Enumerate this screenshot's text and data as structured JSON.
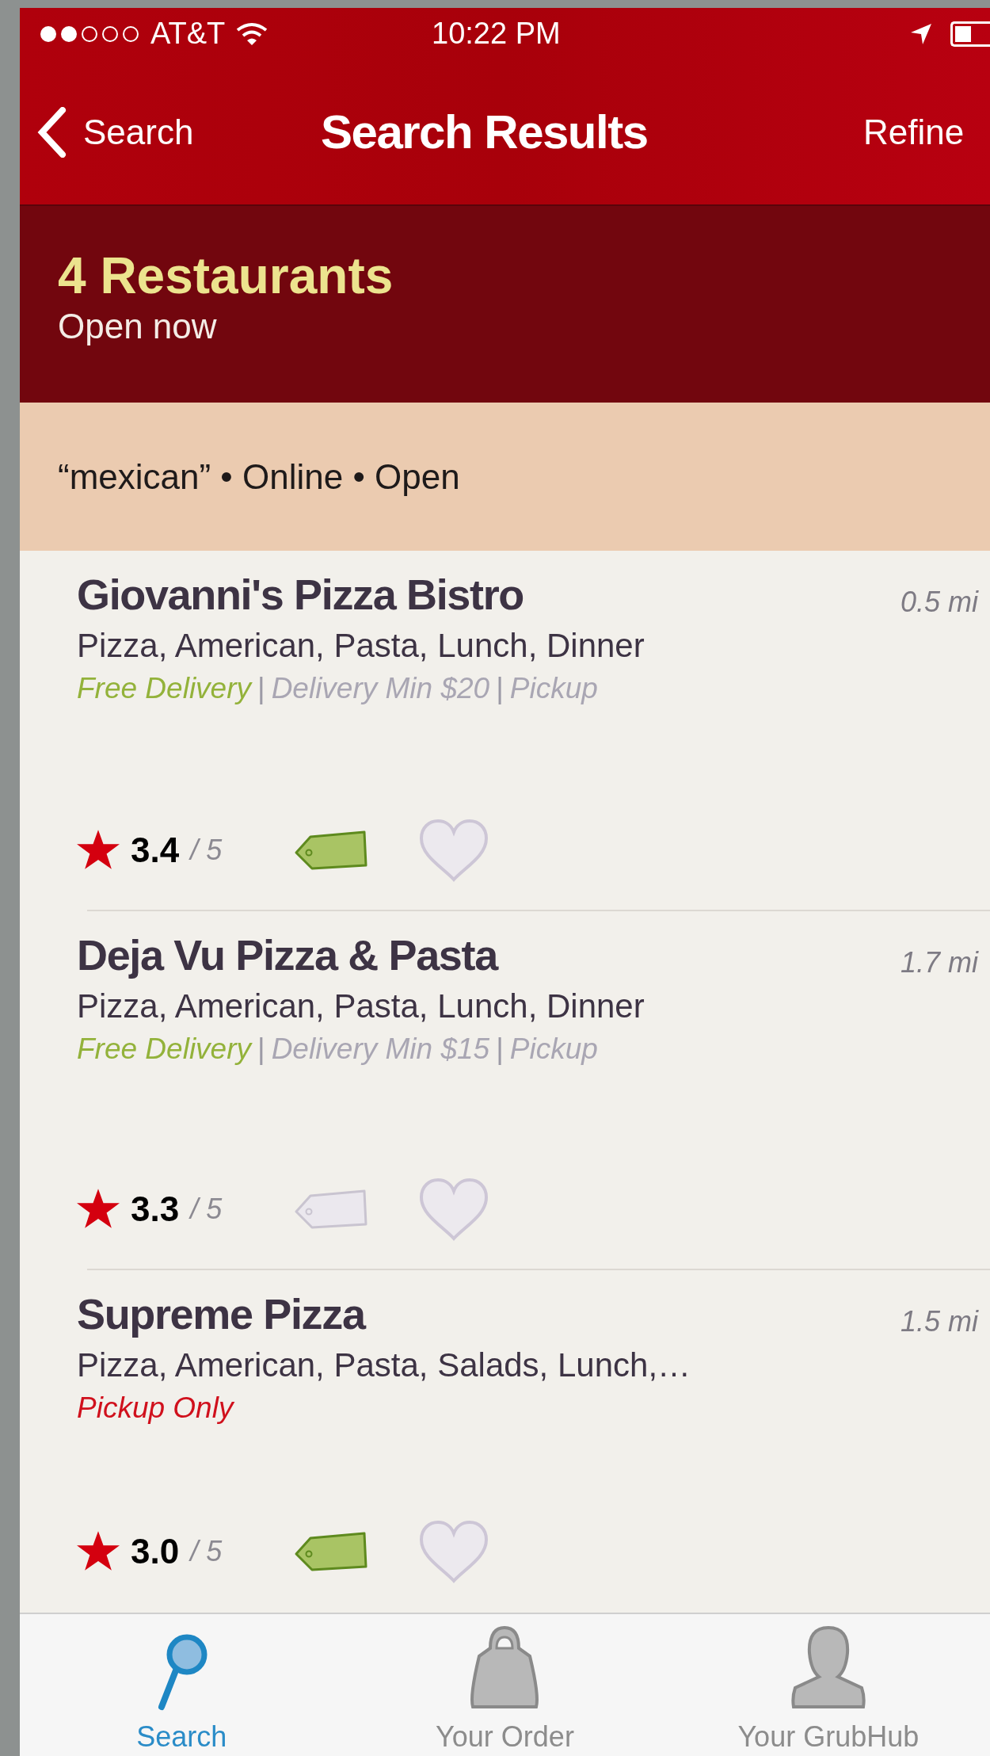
{
  "status_bar": {
    "carrier": "AT&T",
    "time": "10:22 PM"
  },
  "nav": {
    "back": "Search",
    "title": "Search Results",
    "action": "Refine"
  },
  "summary": {
    "count": "4 Restaurants",
    "subtitle": "Open now"
  },
  "filters": "“mexican” • Online • Open",
  "restaurants": [
    {
      "name": "Giovanni's Pizza Bistro",
      "distance": "0.5 mi",
      "cuisines": "Pizza, American, Pasta, Lunch, Dinner",
      "service": [
        {
          "text": "Free Delivery",
          "kind": "free"
        },
        {
          "text": "|",
          "kind": "separator"
        },
        {
          "text": "Delivery Min $20",
          "kind": "detail"
        },
        {
          "text": "|",
          "kind": "separator"
        },
        {
          "text": "Pickup",
          "kind": "detail"
        }
      ],
      "rating": "3.4",
      "rating_max": "/ 5",
      "coupon": true,
      "favorite": false
    },
    {
      "name": "Deja Vu Pizza & Pasta",
      "distance": "1.7 mi",
      "cuisines": "Pizza, American, Pasta, Lunch, Dinner",
      "service": [
        {
          "text": "Free Delivery",
          "kind": "free"
        },
        {
          "text": "|",
          "kind": "separator"
        },
        {
          "text": "Delivery Min $15",
          "kind": "detail"
        },
        {
          "text": "|",
          "kind": "separator"
        },
        {
          "text": "Pickup",
          "kind": "detail"
        }
      ],
      "rating": "3.3",
      "rating_max": "/ 5",
      "coupon": false,
      "favorite": false
    },
    {
      "name": "Supreme Pizza",
      "distance": "1.5 mi",
      "cuisines": "Pizza, American, Pasta, Salads, Lunch,…",
      "service": [
        {
          "text": "Pickup Only",
          "kind": "pickup_only"
        }
      ],
      "rating": "3.0",
      "rating_max": "/ 5",
      "coupon": true,
      "favorite": false
    }
  ],
  "tabs": [
    {
      "label": "Search",
      "selected": true,
      "kind": "search"
    },
    {
      "label": "Your Order",
      "selected": false,
      "kind": "order"
    },
    {
      "label": "Your GrubHub",
      "selected": false,
      "kind": "account"
    }
  ]
}
